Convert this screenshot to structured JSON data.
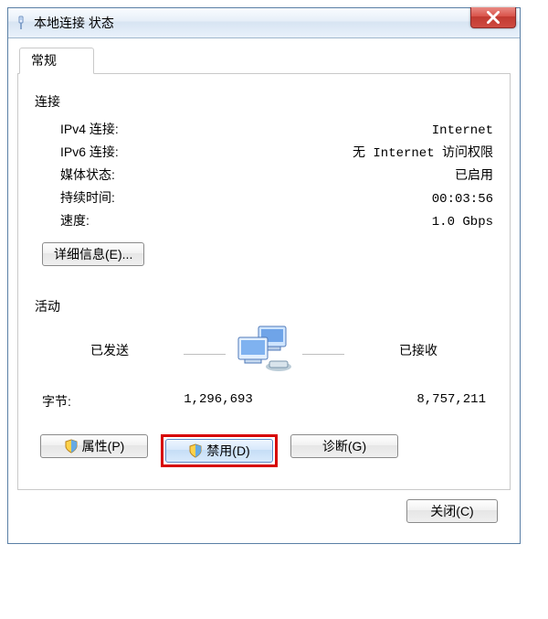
{
  "window": {
    "title": "本地连接 状态"
  },
  "tab": {
    "general": "常规"
  },
  "connection": {
    "section": "连接",
    "ipv4_label": "IPv4 连接:",
    "ipv4_value": "Internet",
    "ipv6_label": "IPv6 连接:",
    "ipv6_value": "无 Internet 访问权限",
    "media_label": "媒体状态:",
    "media_value": "已启用",
    "duration_label": "持续时间:",
    "duration_value": "00:03:56",
    "speed_label": "速度:",
    "speed_value": "1.0 Gbps"
  },
  "buttons": {
    "details": "详细信息(E)...",
    "properties": "属性(P)",
    "disable": "禁用(D)",
    "diagnose": "诊断(G)",
    "close": "关闭(C)"
  },
  "activity": {
    "section": "活动",
    "sent_label": "已发送",
    "received_label": "已接收",
    "bytes_label": "字节:",
    "bytes_sent": "1,296,693",
    "bytes_received": "8,757,211"
  }
}
